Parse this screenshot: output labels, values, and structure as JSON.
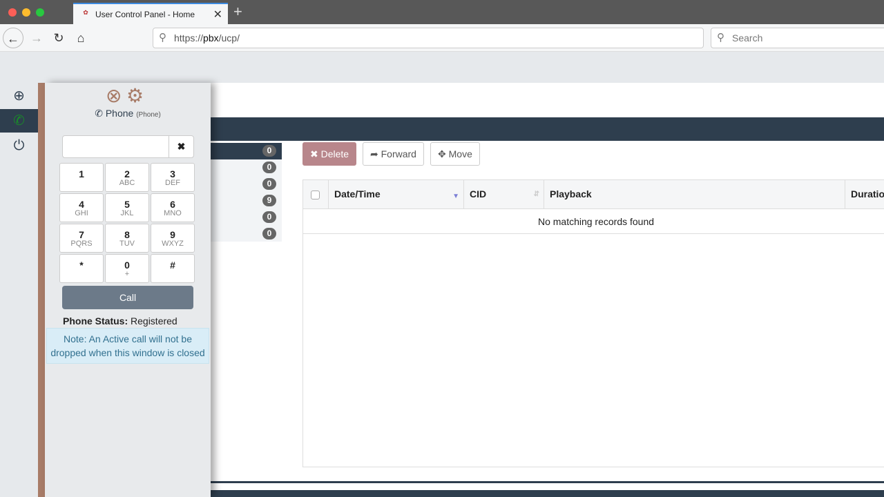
{
  "browser": {
    "tab_title": "User Control Panel - Home",
    "url_prefix": "https://",
    "url_host": "pbx",
    "url_path": "/ucp/",
    "search_placeholder": "Search",
    "favicon_text": "FreePBX"
  },
  "leftnav": {
    "items": [
      {
        "icon": "plus-circle-icon"
      },
      {
        "icon": "phone-icon",
        "active": true
      },
      {
        "icon": "power-icon"
      }
    ]
  },
  "phone_panel": {
    "title": "Phone",
    "subtitle": "(Phone)",
    "clear_symbol": "✖",
    "keys": [
      {
        "n": "1",
        "l": ""
      },
      {
        "n": "2",
        "l": "ABC"
      },
      {
        "n": "3",
        "l": "DEF"
      },
      {
        "n": "4",
        "l": "GHI"
      },
      {
        "n": "5",
        "l": "JKL"
      },
      {
        "n": "6",
        "l": "MNO"
      },
      {
        "n": "7",
        "l": "PQRS"
      },
      {
        "n": "8",
        "l": "TUV"
      },
      {
        "n": "9",
        "l": "WXYZ"
      },
      {
        "n": "*",
        "l": ""
      },
      {
        "n": "0",
        "l": "+"
      },
      {
        "n": "#",
        "l": ""
      }
    ],
    "call_label": "Call",
    "status_label": "Phone Status:",
    "status_value": "Registered",
    "note": "Note: An Active call will not be dropped when this window is closed",
    "accent": "#a87c68"
  },
  "folders": {
    "badges": [
      "0",
      "0",
      "0",
      "9",
      "0",
      "0"
    ]
  },
  "toolbar": {
    "delete": "Delete",
    "forward": "Forward",
    "move": "Move"
  },
  "table": {
    "columns": [
      "Date/Time",
      "CID",
      "Playback",
      "Duration"
    ],
    "empty": "No matching records found"
  },
  "colors": {
    "navy": "#2e3e4e",
    "delete": "#b8868b"
  }
}
